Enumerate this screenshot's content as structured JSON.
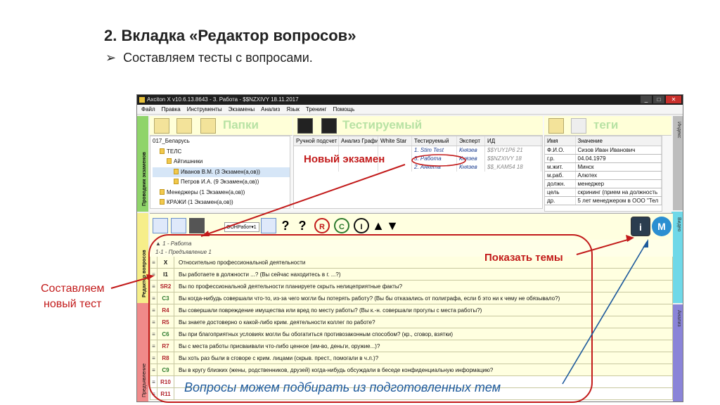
{
  "slide": {
    "title": "2. Вкладка «Редактор вопросов»",
    "bullet": "Составляем тесты с вопросами."
  },
  "window": {
    "title": "Axciton X v10.6.13.8643 - 3. Работа - $$NZXIVY 18.11.2017",
    "controls": [
      "_",
      "□",
      "✕"
    ]
  },
  "menu": [
    "Файл",
    "Правка",
    "Инструменты",
    "Экзамены",
    "Анализ",
    "Язык",
    "Тренинг",
    "Помощь"
  ],
  "side_tabs": {
    "examiner": "Проводник экзаменов",
    "editor": "Редактор вопросов",
    "presentation": "Предъявление"
  },
  "right_tabs": {
    "index": "Индекс",
    "video": "Видео",
    "analysis": "Анализ"
  },
  "folders_panel": {
    "label": "Папки",
    "tree": [
      {
        "text": "017_Беларусь",
        "indent": 0,
        "folder": false
      },
      {
        "text": "ТЕЛС",
        "indent": 1,
        "folder": true
      },
      {
        "text": "Айтишники",
        "indent": 2,
        "folder": true
      },
      {
        "text": "Иванов В.М. (3 Экзамен(а,ов))",
        "indent": 3,
        "folder": true
      },
      {
        "text": "Петров И.А. (9 Экзамен(а,ов))",
        "indent": 3,
        "folder": true
      },
      {
        "text": "Менеджеры (1 Экзамен(а,ов))",
        "indent": 1,
        "folder": true
      },
      {
        "text": "КРАЖИ (1 Экзамен(а,ов))",
        "indent": 1,
        "folder": true
      }
    ]
  },
  "subject_panel": {
    "label": "Тестируемый",
    "headers": [
      "Ручной подсчет",
      "Анализ Графиков",
      "White Star",
      "Тестируемый",
      "Эксперт",
      "ИД"
    ],
    "rows": [
      [
        "",
        "",
        "",
        "1. Stim Test",
        "Князев",
        "$$YUY1P6  21"
      ],
      [
        "",
        "",
        "",
        "3. Работа",
        "Князев",
        "$$NZXIVY  18"
      ],
      [
        "",
        "",
        "",
        "2. Анкета",
        "Князев",
        "$$_KAM54  18"
      ]
    ]
  },
  "tags_panel": {
    "label": "теги",
    "headers": [
      "Имя",
      "Значение"
    ],
    "rows": [
      [
        "Ф.И.О.",
        "Сизов Иван Иванович"
      ],
      [
        "г.р.",
        "04.04.1979"
      ],
      [
        "м.жит.",
        "Минск"
      ],
      [
        "м.раб.",
        "Алютех"
      ],
      [
        "должн.",
        "менеджер"
      ],
      [
        "цель",
        "скрининг (прием на должность"
      ],
      [
        "др.",
        "5 лет менеджером в ООО \"Тел"
      ]
    ]
  },
  "editor_toolbar": {
    "dropdown": "OOHРабот▾1"
  },
  "questions": {
    "group": "1 - Работа",
    "subgroup": "1-1 - Предъявление 1",
    "rows": [
      {
        "code": "X",
        "style": "black",
        "text": "Относительно профессиональной деятельности"
      },
      {
        "code": "I1",
        "style": "black",
        "text": "Вы работаете в должности ...? (Вы сейчас находитесь в г. ...?)"
      },
      {
        "code": "SR2",
        "style": "red",
        "text": "Вы по профессиональной деятельности планируете скрыть нелицеприятные факты?"
      },
      {
        "code": "C3",
        "style": "green",
        "text": "Вы когда-нибудь совершали что-то, из-за чего могли бы потерять работу? (Вы бы отказались от полиграфа, если б это ни к чему не обязывало?)"
      },
      {
        "code": "R4",
        "style": "red",
        "text": "Вы совершали повреждение имущества или вред по месту работы? (Вы к.-н. совершали прогулы с места работы?)"
      },
      {
        "code": "R5",
        "style": "red",
        "text": "Вы знаете достоверно о какой-либо крим. деятельности коллег по работе?"
      },
      {
        "code": "C6",
        "style": "green",
        "text": "Вы при благоприятных условиях могли бы обогатиться противозаконным способом? (кр., сговор, взятки)"
      },
      {
        "code": "R7",
        "style": "red",
        "text": "Вы с места работы присваивали что-либо ценное (им-во, деньги, оружие...)?"
      },
      {
        "code": "R8",
        "style": "red",
        "text": "Вы хоть раз были в сговоре с крим. лицами (скрыв. прест., помогали в ч.л.)?"
      },
      {
        "code": "C9",
        "style": "green",
        "text": "Вы в кругу близких (жены, родственников, друзей) когда-нибудь обсуждали в беседе конфиденциальную информацию?"
      },
      {
        "code": "R10",
        "style": "red",
        "text": ""
      },
      {
        "code": "R11",
        "style": "red",
        "text": ""
      }
    ]
  },
  "annotations": {
    "new_exam": "Новый экзамен",
    "new_test_line1": "Составляем",
    "new_test_line2": "новый тест",
    "show_topics": "Показать темы",
    "pick_questions": "Вопросы можем подбирать из подготовленных тем"
  },
  "colors": {
    "annotation_red": "#c21a1a",
    "annotation_blue": "#1e5a9c",
    "tab_green": "#8fd46a",
    "tab_yellow": "#f6ee8a",
    "tab_pink": "#f08a8a",
    "tab_gray": "#bdbdbd",
    "tab_cyan": "#6fd8e8",
    "tab_purple": "#8a84d8"
  }
}
